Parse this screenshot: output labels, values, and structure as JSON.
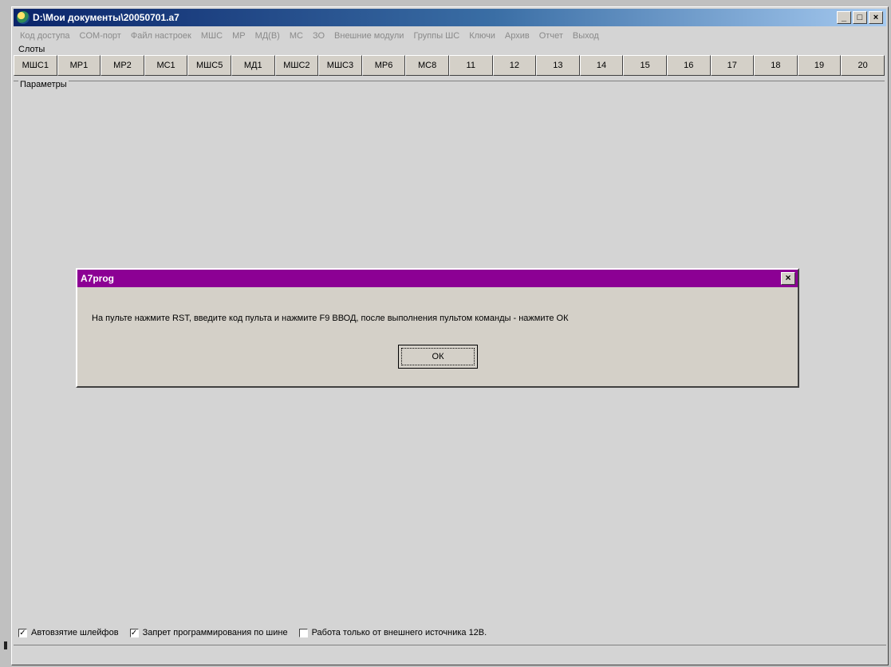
{
  "window": {
    "title": "D:\\Мои документы\\20050701.a7",
    "min_label": "_",
    "max_label": "□",
    "close_label": "×"
  },
  "menu": [
    "Код доступа",
    "COM-порт",
    "Файл настроек",
    "МШС",
    "МР",
    "МД(В)",
    "МС",
    "ЗО",
    "Внешние модули",
    "Группы ШС",
    "Ключи",
    "Архив",
    "Отчет",
    "Выход"
  ],
  "slots": {
    "label": "Слоты",
    "buttons": [
      "МШС1",
      "МР1",
      "МР2",
      "МС1",
      "МШС5",
      "МД1",
      "МШС2",
      "МШС3",
      "МР6",
      "МС8",
      "11",
      "12",
      "13",
      "14",
      "15",
      "16",
      "17",
      "18",
      "19",
      "20"
    ]
  },
  "params": {
    "label": "Параметры"
  },
  "dialog": {
    "title": "A7prog",
    "close_label": "×",
    "message": "На пульте нажмите RST, введите код пульта и нажмите F9 ВВОД, после выполнения пультом команды - нажмите ОК",
    "ok_label": "ОК"
  },
  "options": [
    {
      "label": "Автовзятие шлейфов",
      "checked": true,
      "mark": "✓"
    },
    {
      "label": "Запрет программирования по шине",
      "checked": true,
      "mark": "✓"
    },
    {
      "label": "Работа только от внешнего источника 12В.",
      "checked": false,
      "mark": ""
    }
  ]
}
